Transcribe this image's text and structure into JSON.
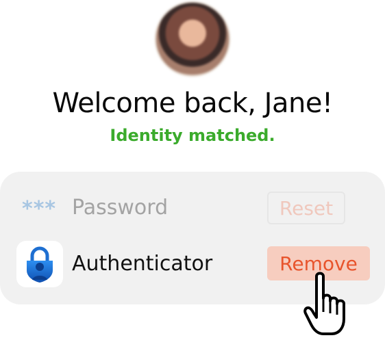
{
  "user": {
    "avatar_icon": "user-avatar-photo",
    "greeting": "Welcome back, Jane!",
    "status": "Identity matched."
  },
  "methods": {
    "password": {
      "icon": "***",
      "label": "Password",
      "action_label": "Reset"
    },
    "authenticator": {
      "icon": "microsoft-authenticator-lock-icon",
      "label": "Authenticator",
      "action_label": "Remove"
    }
  },
  "cursor": {
    "icon": "hand-pointer-icon"
  },
  "colors": {
    "status_green": "#3bab2c",
    "remove_text": "#e8542c",
    "remove_bg": "#f7cdbf",
    "card_bg": "#f1f1f1",
    "authenticator_blue": "#1e6fd1"
  }
}
